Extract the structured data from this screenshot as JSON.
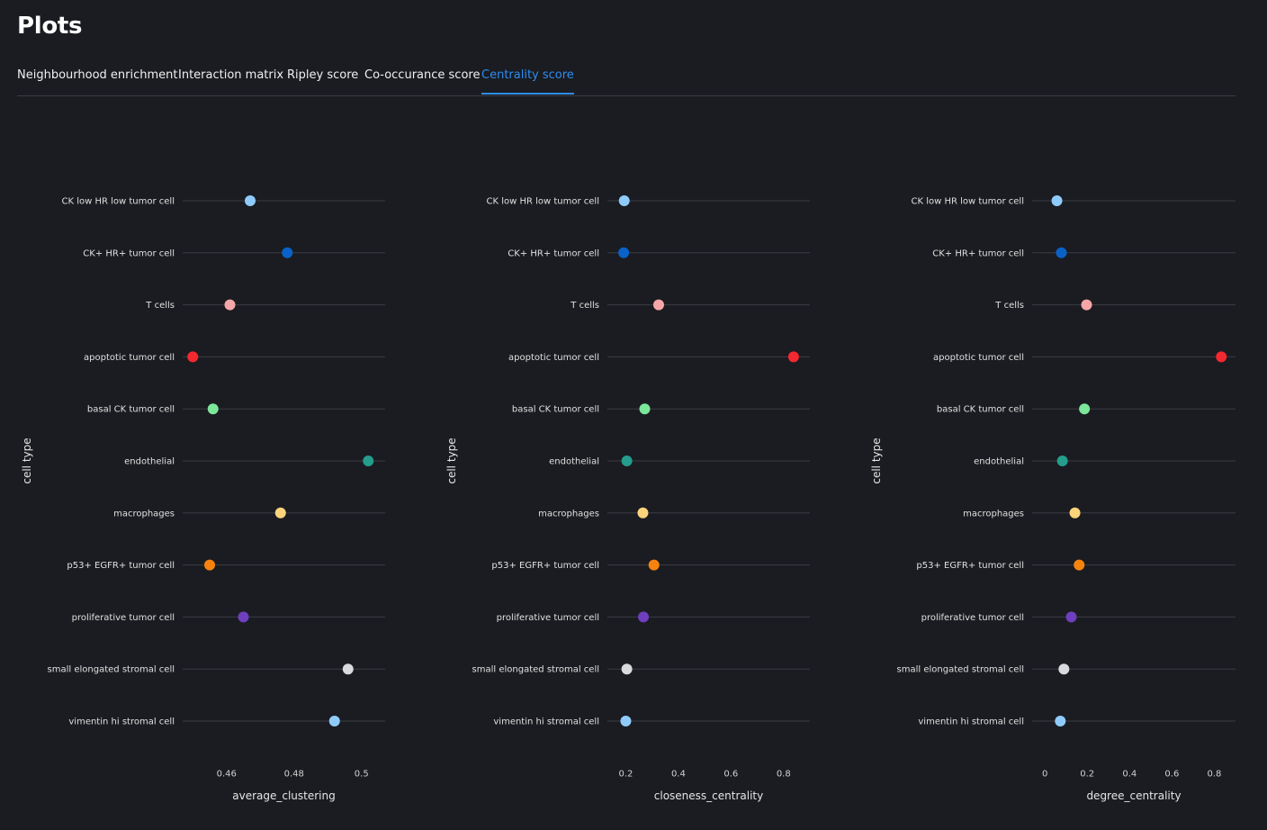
{
  "page": {
    "title": "Plots"
  },
  "tabs": [
    {
      "label": "Neighbourhood enrichment",
      "active": false
    },
    {
      "label": "Interaction matrix",
      "active": false
    },
    {
      "label": "Ripley score",
      "active": false
    },
    {
      "label": "Co-occurance score",
      "active": false
    },
    {
      "label": "Centrality score",
      "active": true
    }
  ],
  "colors": {
    "background": "#1a1c21",
    "accent": "#2d8cf0",
    "gridline": "#3a3d44"
  },
  "chart_data": [
    {
      "type": "scatter",
      "xlabel": "average_clustering",
      "ylabel": "cell type",
      "categories": [
        "CK low HR low tumor cell",
        "CK+ HR+ tumor cell",
        "T cells",
        "apoptotic tumor cell",
        "basal CK tumor cell",
        "endothelial",
        "macrophages",
        "p53+ EGFR+ tumor cell",
        "proliferative tumor cell",
        "small elongated stromal cell",
        "vimentin hi stromal cell"
      ],
      "values": [
        0.467,
        0.478,
        0.461,
        0.45,
        0.456,
        0.502,
        0.476,
        0.455,
        0.465,
        0.496,
        0.492
      ],
      "xlim": [
        0.447,
        0.507
      ],
      "xticks": [
        0.46,
        0.48,
        0.5
      ],
      "xtick_labels": [
        "0.46",
        "0.48",
        "0.5"
      ],
      "grid": "horizontal"
    },
    {
      "type": "scatter",
      "xlabel": "closeness_centrality",
      "ylabel": "cell type",
      "categories": [
        "CK low HR low tumor cell",
        "CK+ HR+ tumor cell",
        "T cells",
        "apoptotic tumor cell",
        "basal CK tumor cell",
        "endothelial",
        "macrophages",
        "p53+ EGFR+ tumor cell",
        "proliferative tumor cell",
        "small elongated stromal cell",
        "vimentin hi stromal cell"
      ],
      "values": [
        0.194,
        0.192,
        0.325,
        0.838,
        0.272,
        0.204,
        0.265,
        0.307,
        0.267,
        0.204,
        0.2
      ],
      "xlim": [
        0.13,
        0.9
      ],
      "xticks": [
        0.2,
        0.4,
        0.6,
        0.8
      ],
      "xtick_labels": [
        "0.2",
        "0.4",
        "0.6",
        "0.8"
      ],
      "grid": "horizontal"
    },
    {
      "type": "scatter",
      "xlabel": "degree_centrality",
      "ylabel": "cell type",
      "categories": [
        "CK low HR low tumor cell",
        "CK+ HR+ tumor cell",
        "T cells",
        "apoptotic tumor cell",
        "basal CK tumor cell",
        "endothelial",
        "macrophages",
        "p53+ EGFR+ tumor cell",
        "proliferative tumor cell",
        "small elongated stromal cell",
        "vimentin hi stromal cell"
      ],
      "values": [
        0.057,
        0.078,
        0.197,
        0.833,
        0.187,
        0.083,
        0.142,
        0.162,
        0.125,
        0.09,
        0.073
      ],
      "xlim": [
        -0.06,
        0.9
      ],
      "xticks": [
        0,
        0.2,
        0.4,
        0.6,
        0.8
      ],
      "xtick_labels": [
        "0",
        "0.2",
        "0.4",
        "0.6",
        "0.8"
      ],
      "grid": "horizontal"
    }
  ],
  "category_colors": [
    "#8fcbfa",
    "#0a62c8",
    "#f7a6a8",
    "#f42830",
    "#7ce69a",
    "#249d8c",
    "#fdd37b",
    "#f7830f",
    "#6f3fc0",
    "#d8dadd",
    "#8fcbfa"
  ]
}
